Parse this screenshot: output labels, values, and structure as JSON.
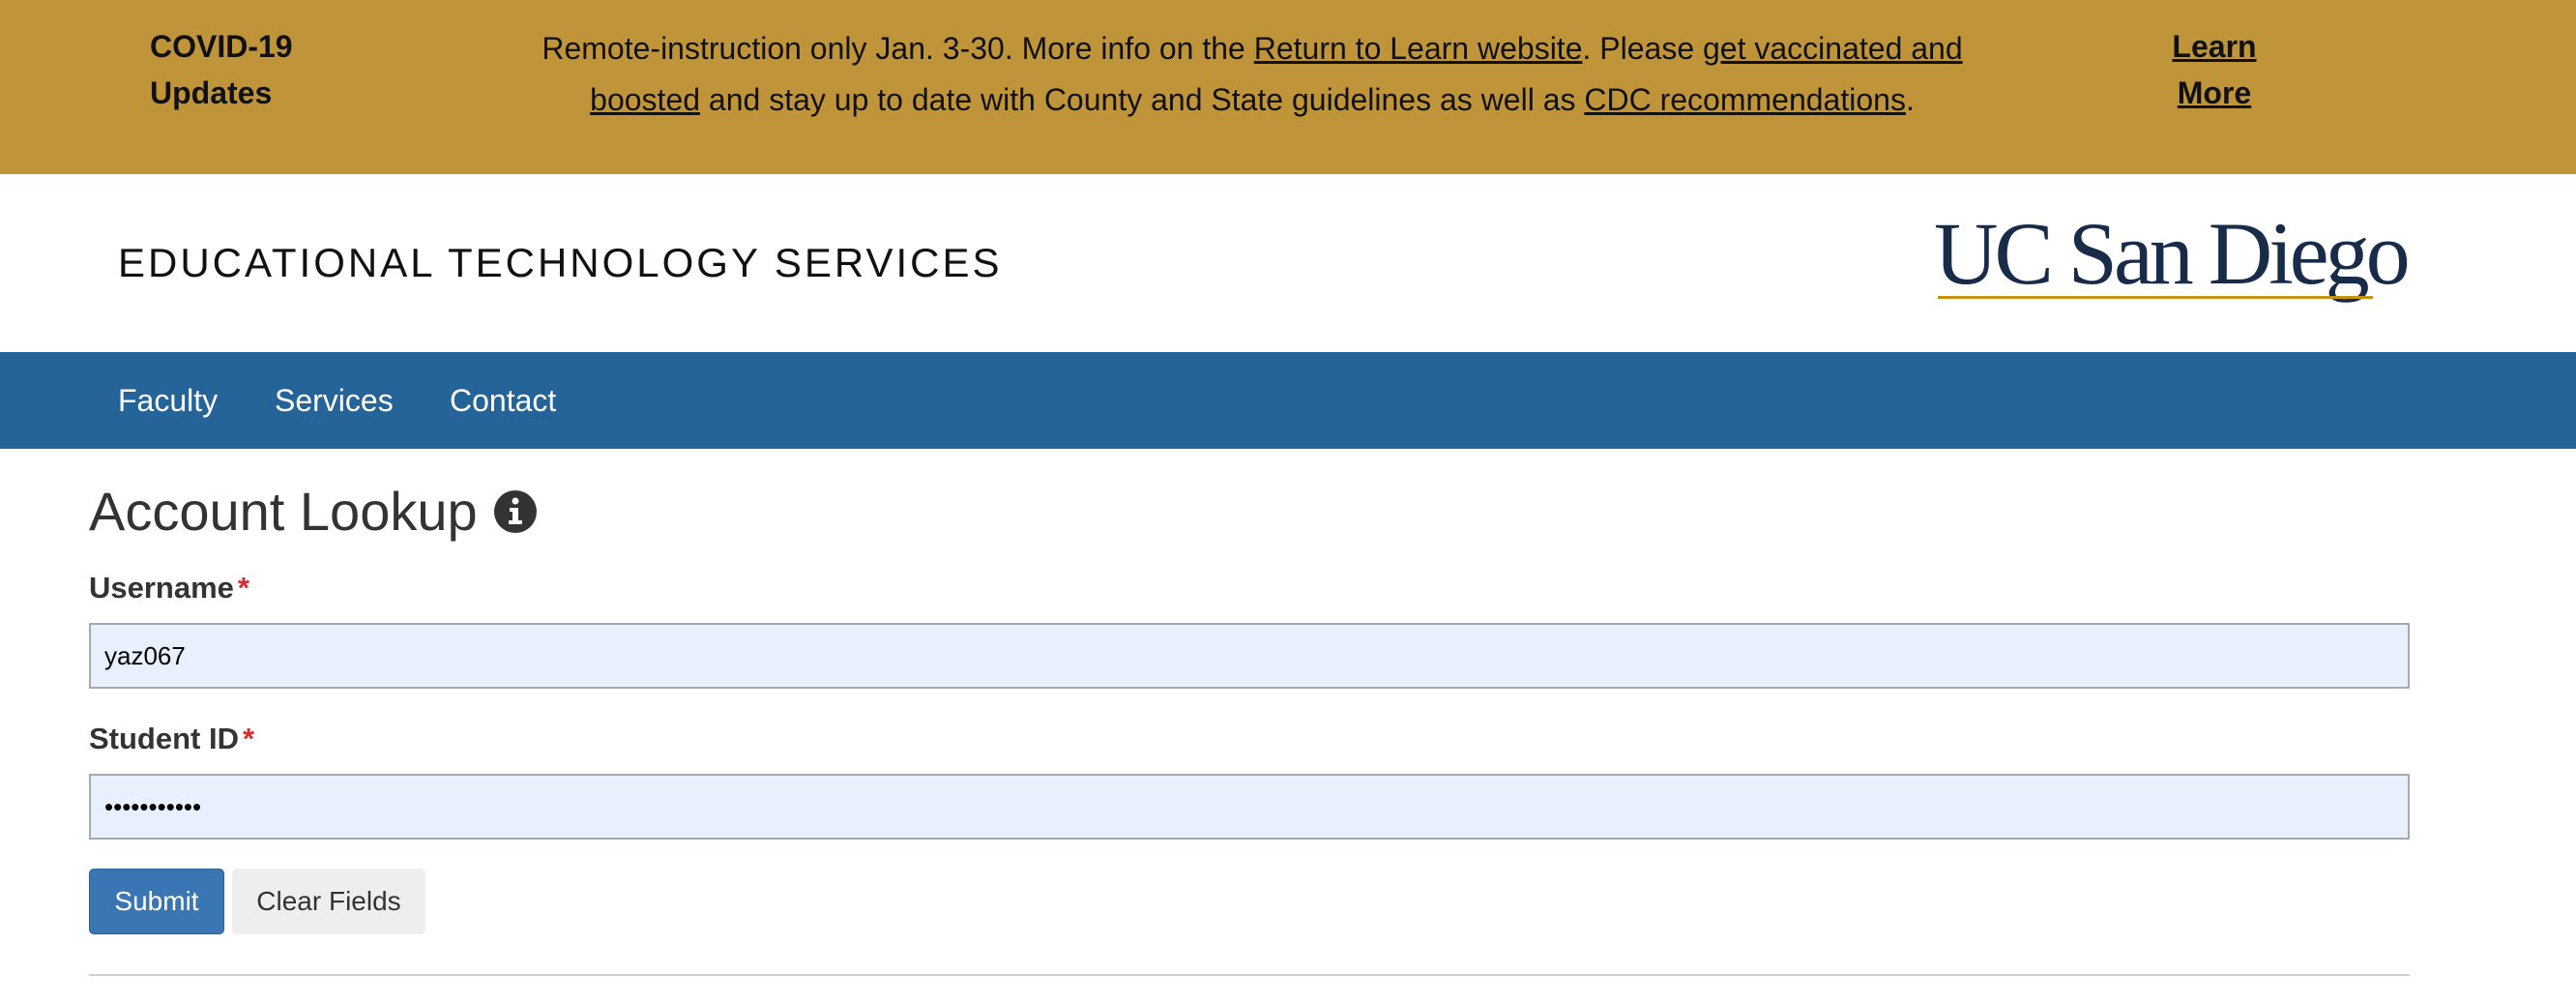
{
  "banner": {
    "title": "COVID-19 Updates",
    "message_part1": "Remote-instruction only Jan. 3-30. More info on the ",
    "link_return": "Return to Learn website",
    "message_part2": ". Please ",
    "link_vaccine": "get vaccinated and boosted",
    "message_part3": " and stay up to date with County and State guidelines as well as ",
    "link_cdc": "CDC recommendations",
    "message_part4": ".",
    "learn_more": "Learn More",
    "background_color": "#c0953a"
  },
  "header": {
    "site_title": "EDUCATIONAL TECHNOLOGY SERVICES",
    "logo_text": "UC San Diego",
    "logo_color": "#182b49",
    "logo_accent": "#c69214"
  },
  "nav": {
    "background_color": "#246498",
    "items": [
      {
        "label": "Faculty"
      },
      {
        "label": "Services"
      },
      {
        "label": "Contact"
      }
    ]
  },
  "form": {
    "title": "Account Lookup",
    "info_icon": "info-circle-icon",
    "username_label": "Username",
    "username_value": "yaz067",
    "student_id_label": "Student ID",
    "student_id_value": "•••••••••••",
    "required_marker": "*",
    "submit_label": "Submit",
    "clear_label": "Clear Fields",
    "submit_color": "#3a76b4",
    "required_color": "#d32f2f"
  }
}
